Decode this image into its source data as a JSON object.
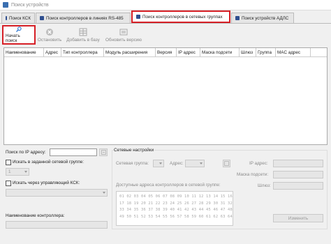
{
  "window": {
    "title": "Поиск устройств"
  },
  "tabs": [
    {
      "label": "Поиск КСК",
      "active": false
    },
    {
      "label": "Поиск контроллеров в линиях RS-485",
      "active": false
    },
    {
      "label": "Поиск контроллеров в сетевых группах",
      "active": true
    },
    {
      "label": "Поиск устройств АДЛС",
      "active": false
    }
  ],
  "toolbar": {
    "start_search": "Начать поиск",
    "stop": "Остановить",
    "add_to_db": "Добавить в базу",
    "update_version": "Обновить версию"
  },
  "grid": {
    "columns": [
      "Наименование",
      "Адрес",
      "Тип контроллера",
      "Модуль расширения",
      "Версия",
      "IP адрес",
      "Маска подсети",
      "Шлюз",
      "Группа",
      "MAC адрес"
    ]
  },
  "left_panel": {
    "ip_search_label": "Поиск по IP адресу:",
    "in_group_label": "Искать в заданной сетевой группе:",
    "group_select_value": "1",
    "via_ksk_label": "Искать через управляющий КСК:",
    "controller_name_label": "Наименование контроллера:"
  },
  "network_settings": {
    "title": "Сетевые настройки",
    "network_group_label": "Сетевая группа:",
    "address_label": "Адрес:",
    "ip_label": "IP адрес:",
    "mask_label": "Маска подсети:",
    "gateway_label": "Шлюз:",
    "available_label": "Доступные адреса контроллеров в сетевой группе:",
    "address_rows": [
      "01 02 03 04 05 06 07 08 09 10 11 12 13 14 15 16",
      "17 18 19 20 21 22 23 24 25 26 27 28 29 30 31 32",
      "33 34 35 36 37 38 39 40 41 42 43 44 45 46 47 48",
      "49 50 51 52 53 54 55 56 57 58 59 60 61 62 63 64"
    ],
    "change_button": "Изменить"
  }
}
